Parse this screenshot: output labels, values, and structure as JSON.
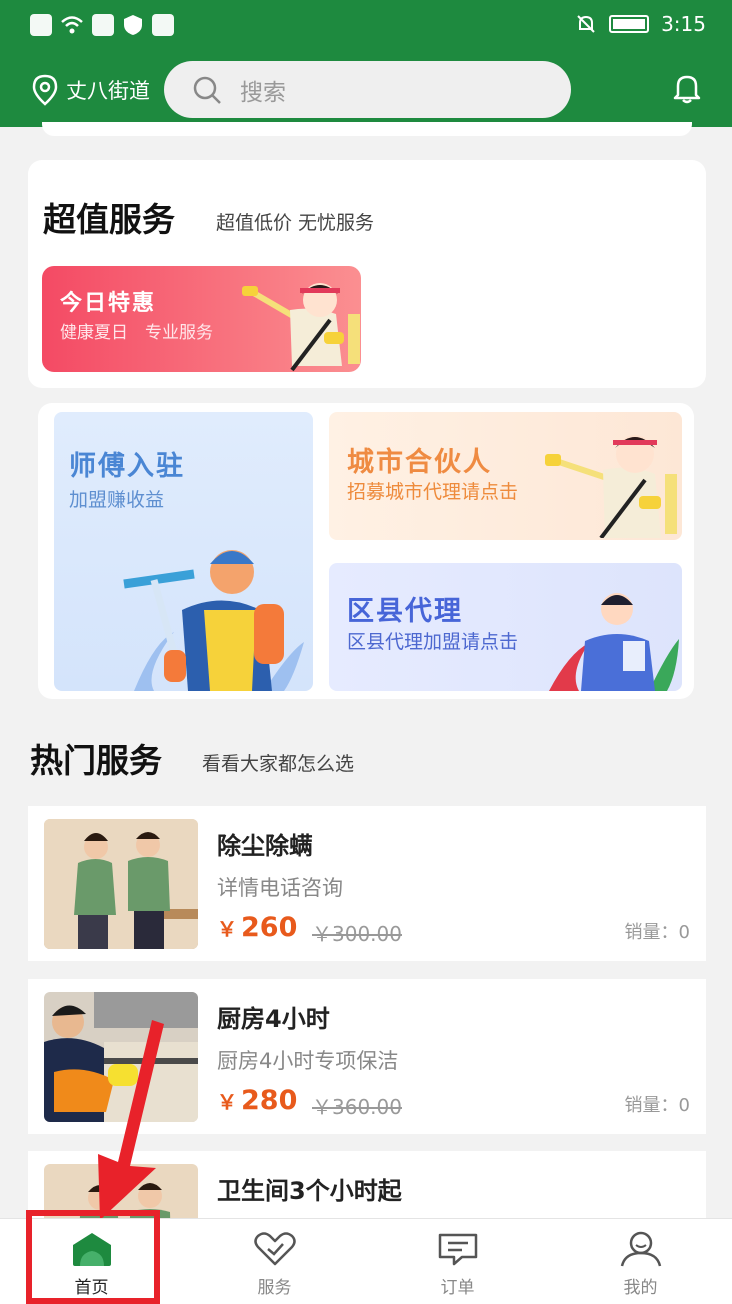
{
  "status_bar": {
    "time": "3:15"
  },
  "header": {
    "location": "丈八街道",
    "search_placeholder": "搜索"
  },
  "value_section": {
    "title": "超值服务",
    "subtitle": "超值低价 无忧服务",
    "promo": {
      "title": "今日特惠",
      "subtitle": "健康夏日　专业服务"
    }
  },
  "join_tiles": [
    {
      "title": "师傅入驻",
      "subtitle": "加盟赚收益"
    },
    {
      "title": "城市合伙人",
      "subtitle": "招募城市代理请点击"
    },
    {
      "title": "区县代理",
      "subtitle": "区县代理加盟请点击"
    }
  ],
  "hot_section": {
    "title": "热门服务",
    "subtitle": "看看大家都怎么选"
  },
  "services": [
    {
      "name": "除尘除螨",
      "desc": "详情电话咨询",
      "currency": "￥",
      "price": "260",
      "old_price": "￥300.00",
      "sales": "销量：0"
    },
    {
      "name": "厨房4小时",
      "desc": "厨房4小时专项保洁",
      "currency": "￥",
      "price": "280",
      "old_price": "￥360.00",
      "sales": "销量：0"
    },
    {
      "name": "卫生间3个小时起"
    }
  ],
  "tabs": [
    {
      "label": "首页",
      "icon": "home-icon",
      "active": true
    },
    {
      "label": "服务",
      "icon": "heart-icon",
      "active": false
    },
    {
      "label": "订单",
      "icon": "message-icon",
      "active": false
    },
    {
      "label": "我的",
      "icon": "user-icon",
      "active": false
    }
  ],
  "colors": {
    "brand_green": "#1e8a3f",
    "price_orange": "#e85a1c",
    "annotation_red": "#e8222a"
  }
}
